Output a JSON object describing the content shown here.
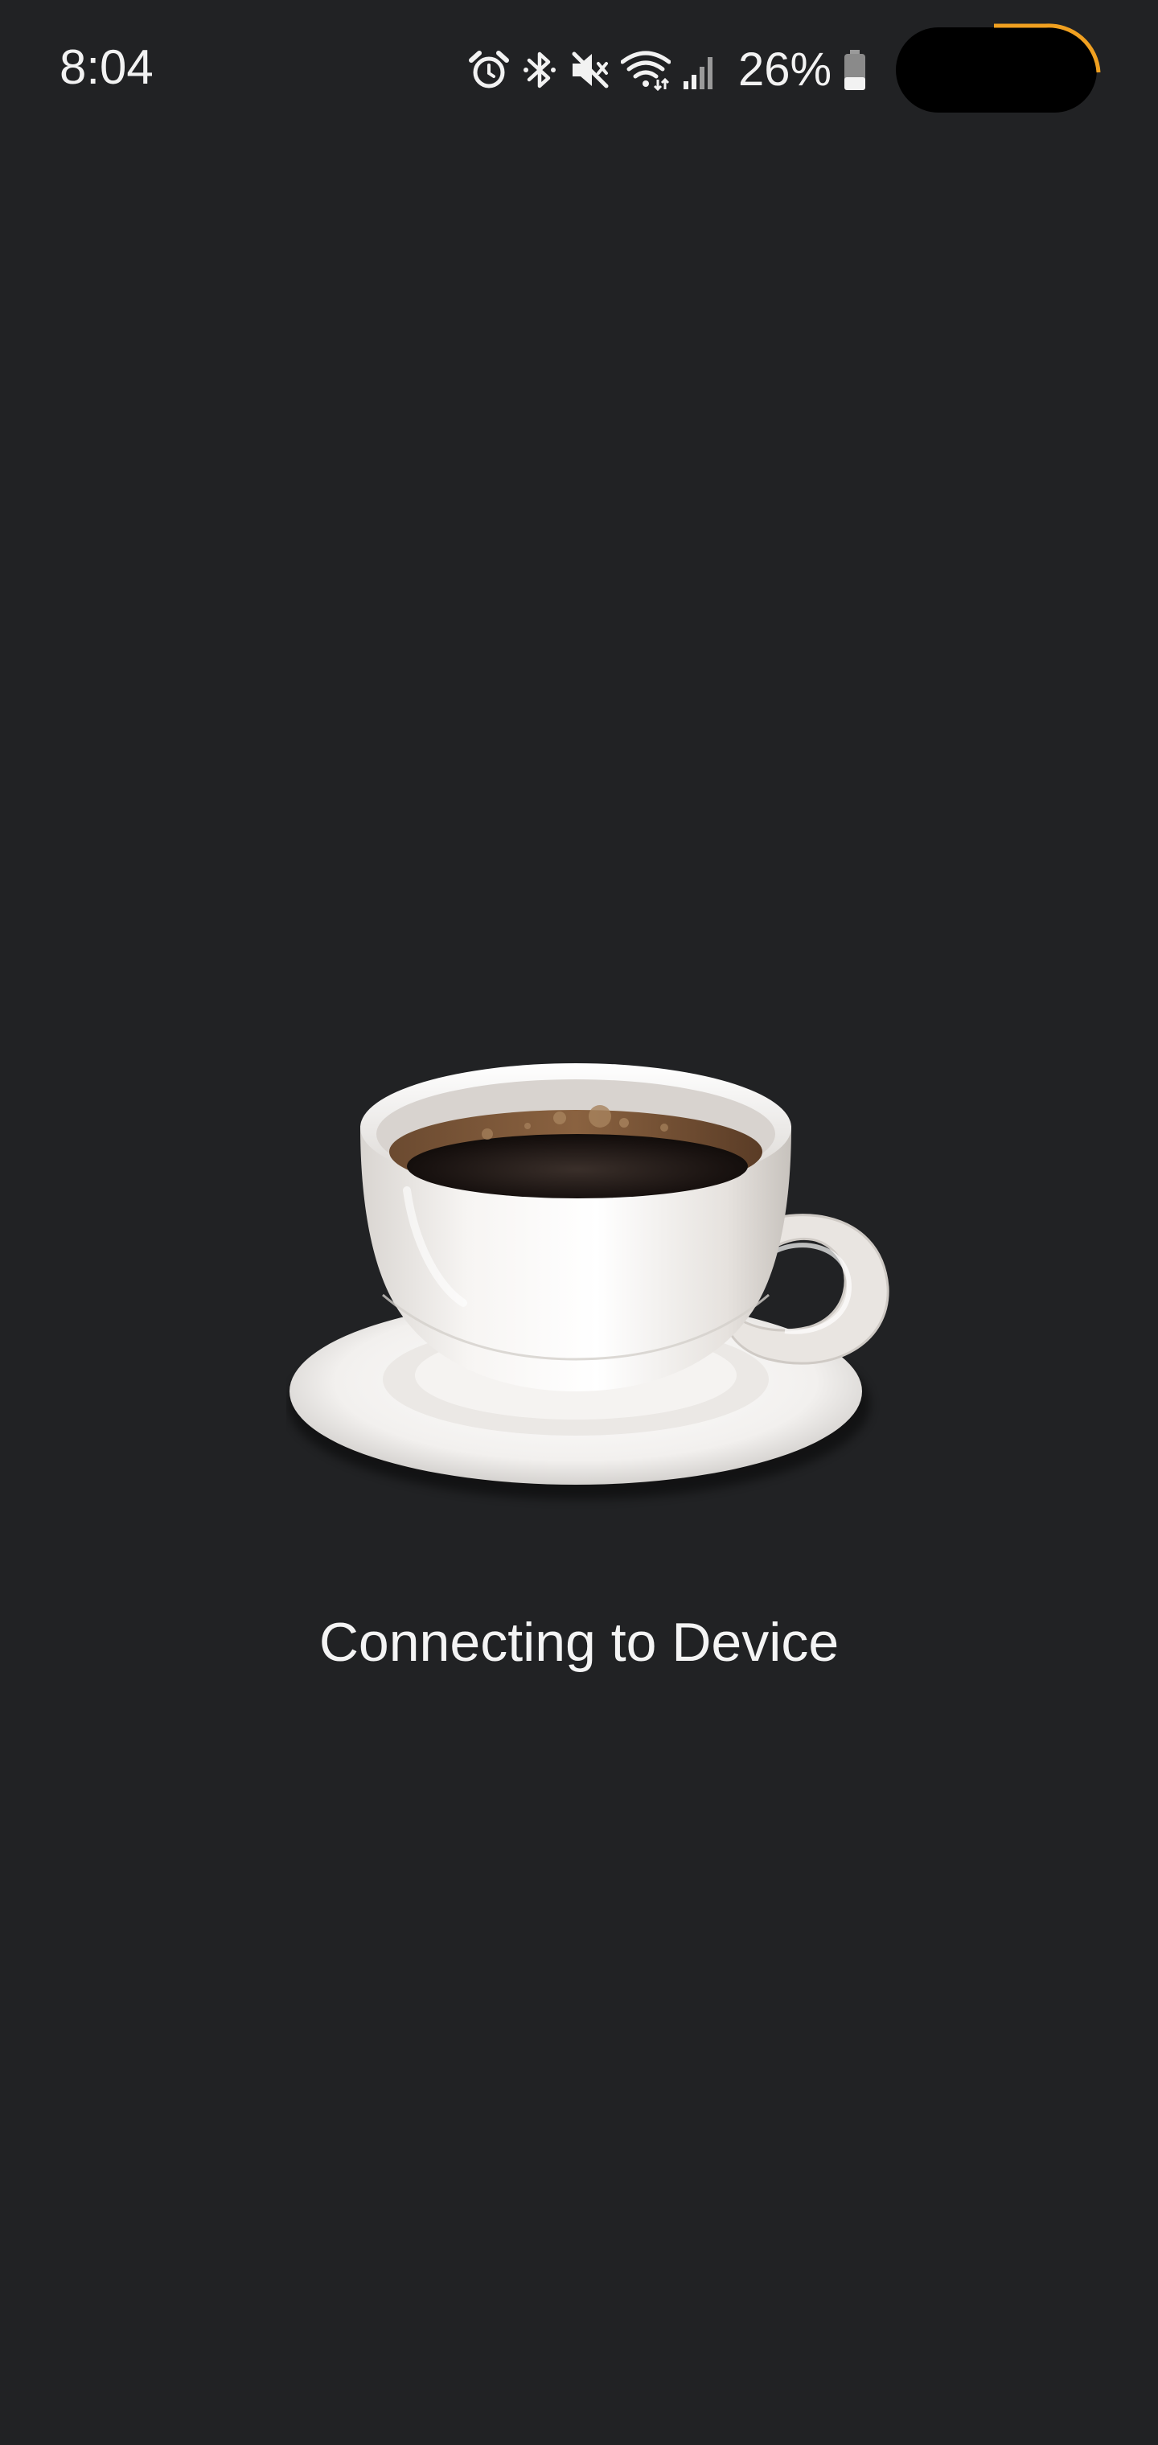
{
  "status_bar": {
    "time": "8:04",
    "battery_percent": "26%",
    "icons": [
      "alarm-icon",
      "bluetooth-icon",
      "mute-icon",
      "wifi-icon",
      "signal-icon",
      "battery-icon"
    ],
    "battery_level": 0.26
  },
  "main": {
    "image": "coffee-cup-icon",
    "status_message": "Connecting to Device"
  },
  "colors": {
    "background": "#212224",
    "text": "#f4f4f4",
    "camera_accent": "#f0a020"
  }
}
